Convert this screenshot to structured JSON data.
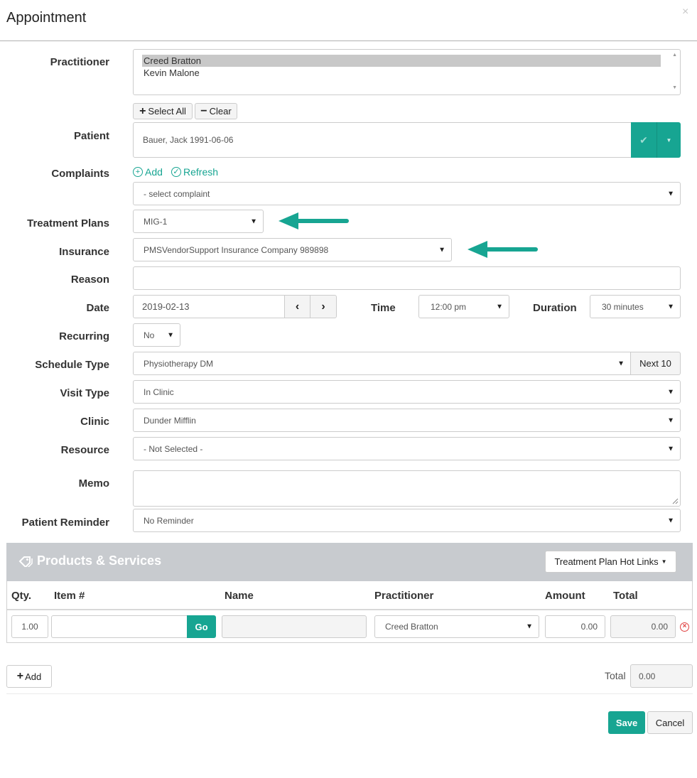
{
  "dialog": {
    "title": "Appointment",
    "close": "×"
  },
  "practitioner": {
    "label": "Practitioner",
    "options": [
      "Creed Bratton",
      "Kevin Malone"
    ],
    "select_all_label": "Select All",
    "clear_label": "Clear"
  },
  "patient": {
    "label": "Patient",
    "value": "Bauer, Jack 1991-06-06"
  },
  "complaints": {
    "label": "Complaints",
    "add_label": "Add",
    "refresh_label": "Refresh",
    "value": "- select complaint"
  },
  "treatment_plans": {
    "label": "Treatment Plans",
    "value": "MIG-1"
  },
  "insurance": {
    "label": "Insurance",
    "value": "PMSVendorSupport Insurance Company 989898"
  },
  "reason": {
    "label": "Reason",
    "value": ""
  },
  "date": {
    "label": "Date",
    "value": "2019-02-13"
  },
  "time": {
    "label": "Time",
    "value": "12:00 pm"
  },
  "duration": {
    "label": "Duration",
    "value": "30 minutes"
  },
  "recurring": {
    "label": "Recurring",
    "value": "No"
  },
  "schedule_type": {
    "label": "Schedule Type",
    "value": "Physiotherapy DM",
    "next_label": "Next 10"
  },
  "visit_type": {
    "label": "Visit Type",
    "value": "In Clinic"
  },
  "clinic": {
    "label": "Clinic",
    "value": "Dunder Mifflin"
  },
  "resource": {
    "label": "Resource",
    "value": "- Not Selected -"
  },
  "memo": {
    "label": "Memo",
    "value": ""
  },
  "patient_reminder": {
    "label": "Patient Reminder",
    "value": "No Reminder"
  },
  "products": {
    "title": "Products & Services",
    "hot_links_label": "Treatment Plan Hot Links",
    "columns": [
      "Qty.",
      "Item #",
      "Name",
      "Practitioner",
      "Amount",
      "Total"
    ],
    "row": {
      "qty": "1.00",
      "item": "",
      "go_label": "Go",
      "name": "",
      "practitioner": "Creed Bratton",
      "amount": "0.00",
      "total": "0.00"
    }
  },
  "footer": {
    "add_label": "Add",
    "total_label": "Total",
    "total_value": "0.00",
    "save_label": "Save",
    "cancel_label": "Cancel"
  },
  "colors": {
    "accent": "#17a592",
    "header_bg": "#c8cbcf",
    "danger": "#e04040"
  }
}
